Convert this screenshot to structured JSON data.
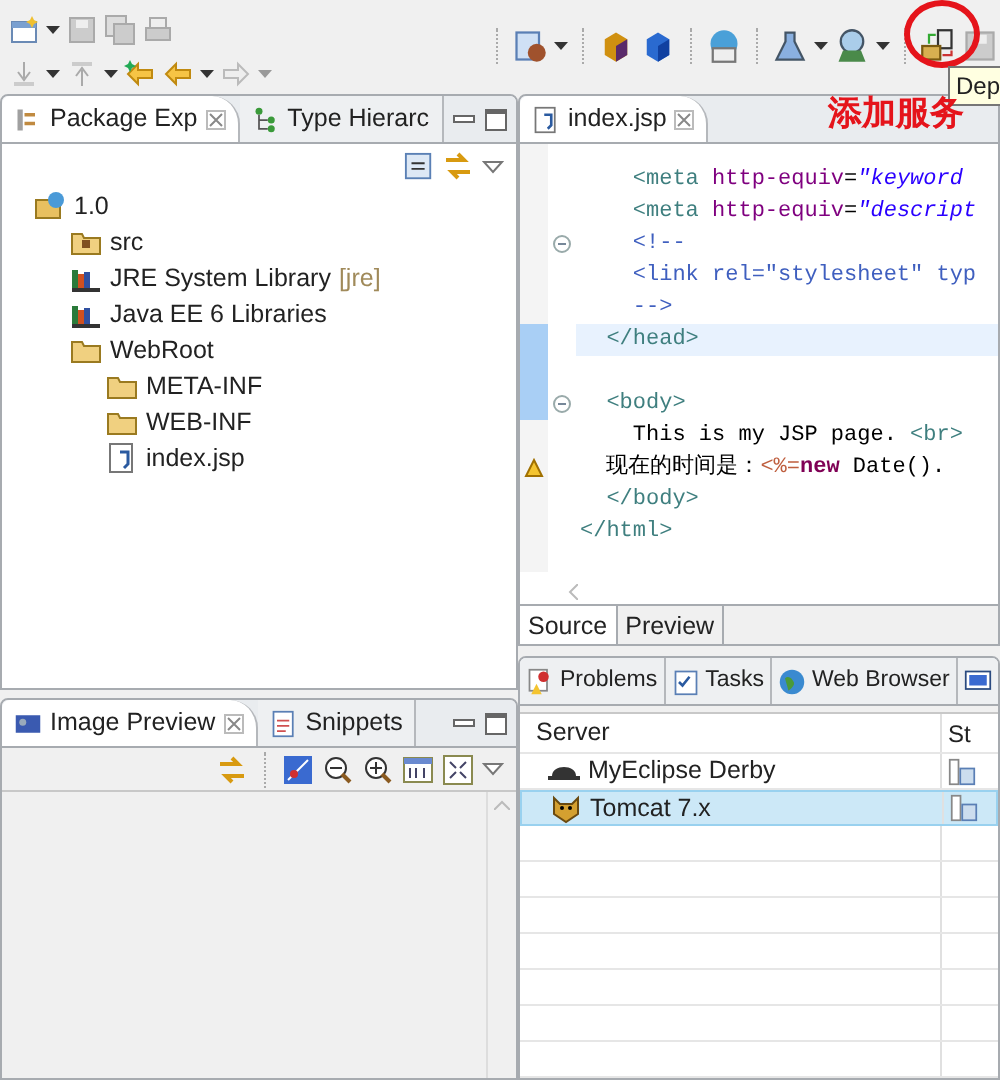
{
  "annotation": {
    "text": "添加服务"
  },
  "tooltip": {
    "text": "Dep"
  },
  "left_tabs": [
    {
      "label": "Package Exp",
      "selected": true,
      "closable": true
    },
    {
      "label": "Type Hierarc",
      "selected": false,
      "closable": false
    }
  ],
  "tree": [
    {
      "label": "1.0",
      "kind": "project",
      "children": [
        {
          "label": "src",
          "kind": "source"
        },
        {
          "label": "JRE System Library",
          "decoration": "[jre]",
          "kind": "library"
        },
        {
          "label": "Java EE 6 Libraries",
          "kind": "library"
        },
        {
          "label": "WebRoot",
          "kind": "folder",
          "children": [
            {
              "label": "META-INF",
              "kind": "folder"
            },
            {
              "label": "WEB-INF",
              "kind": "folder"
            },
            {
              "label": "index.jsp",
              "kind": "file"
            }
          ]
        }
      ]
    }
  ],
  "editor_tab": {
    "label": "index.jsp"
  },
  "code": [
    {
      "tokens": [
        {
          "kind": "tag",
          "text": "    <meta "
        },
        {
          "kind": "attr",
          "text": "http-equiv"
        },
        {
          "kind": "text",
          "text": "="
        },
        {
          "kind": "value",
          "text": "\"keyword"
        }
      ]
    },
    {
      "tokens": [
        {
          "kind": "tag",
          "text": "    <meta "
        },
        {
          "kind": "attr",
          "text": "http-equiv"
        },
        {
          "kind": "text",
          "text": "="
        },
        {
          "kind": "value",
          "text": "\"descript"
        }
      ]
    },
    {
      "fold": true,
      "tokens": [
        {
          "kind": "comment",
          "text": "    <!--"
        }
      ]
    },
    {
      "tokens": [
        {
          "kind": "comment",
          "text": "    <link rel=\"stylesheet\" typ"
        }
      ]
    },
    {
      "tokens": [
        {
          "kind": "comment",
          "text": "    -->"
        }
      ]
    },
    {
      "current": true,
      "tokens": [
        {
          "kind": "tag",
          "text": "  </head>"
        }
      ]
    },
    {
      "fold": true,
      "gap_before": true,
      "tokens": [
        {
          "kind": "tag",
          "text": "  <body>"
        }
      ]
    },
    {
      "tokens": [
        {
          "kind": "text",
          "text": "    This is my JSP page. "
        },
        {
          "kind": "tag",
          "text": "<br>"
        }
      ]
    },
    {
      "warning": true,
      "tokens": [
        {
          "kind": "text",
          "text": "  现在的时间是："
        },
        {
          "kind": "jsp",
          "text": "<%="
        },
        {
          "kind": "keyword",
          "text": "new"
        },
        {
          "kind": "text",
          "text": " Date()."
        }
      ]
    },
    {
      "tokens": [
        {
          "kind": "tag",
          "text": "  </body>"
        }
      ]
    },
    {
      "tokens": [
        {
          "kind": "tag",
          "text": "</html>"
        }
      ]
    }
  ],
  "editor_bottom_tabs": [
    {
      "label": "Source",
      "selected": true
    },
    {
      "label": "Preview",
      "selected": false
    }
  ],
  "preview_tabs": [
    {
      "label": "Image Preview",
      "selected": true,
      "closable": true
    },
    {
      "label": "Snippets",
      "selected": false,
      "closable": false
    }
  ],
  "server_tabs": [
    {
      "label": "Problems",
      "selected": false
    },
    {
      "label": "Tasks",
      "selected": false
    },
    {
      "label": "Web Browser",
      "selected": false
    }
  ],
  "servers": {
    "columns": [
      "Server",
      "St"
    ],
    "rows": [
      {
        "name": "MyEclipse Derby",
        "kind": "derby",
        "selected": false
      },
      {
        "name": "Tomcat  7.x",
        "kind": "tomcat",
        "selected": true
      }
    ]
  }
}
